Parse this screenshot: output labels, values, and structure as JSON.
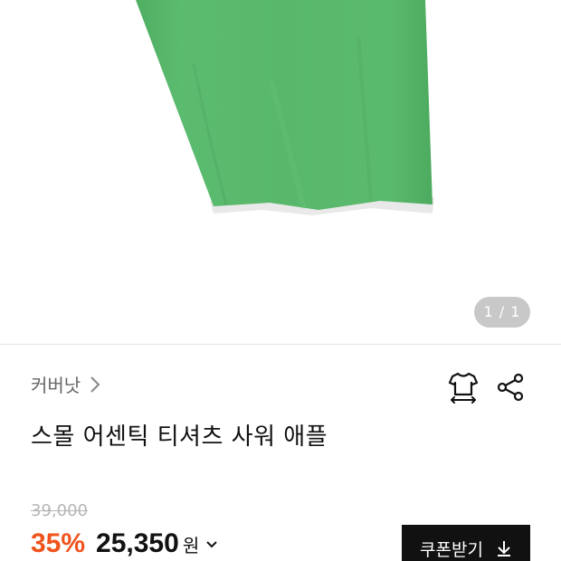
{
  "product_image": {
    "color": "#58b76b",
    "pager": "1 / 1"
  },
  "brand": {
    "name": "커버낫"
  },
  "actions": {
    "size_icon": "tshirt-size-icon",
    "share_icon": "share-icon"
  },
  "product": {
    "title": "스몰 어센틱 티셔츠 사워 애플"
  },
  "price": {
    "original": "39,000",
    "discount": "35%",
    "sale": "25,350",
    "currency": "원"
  },
  "coupon": {
    "label": "쿠폰받기",
    "icon": "download-icon"
  },
  "colors": {
    "discount": "#f0531c",
    "button_bg": "#111111",
    "shirt": "#58b76b"
  }
}
